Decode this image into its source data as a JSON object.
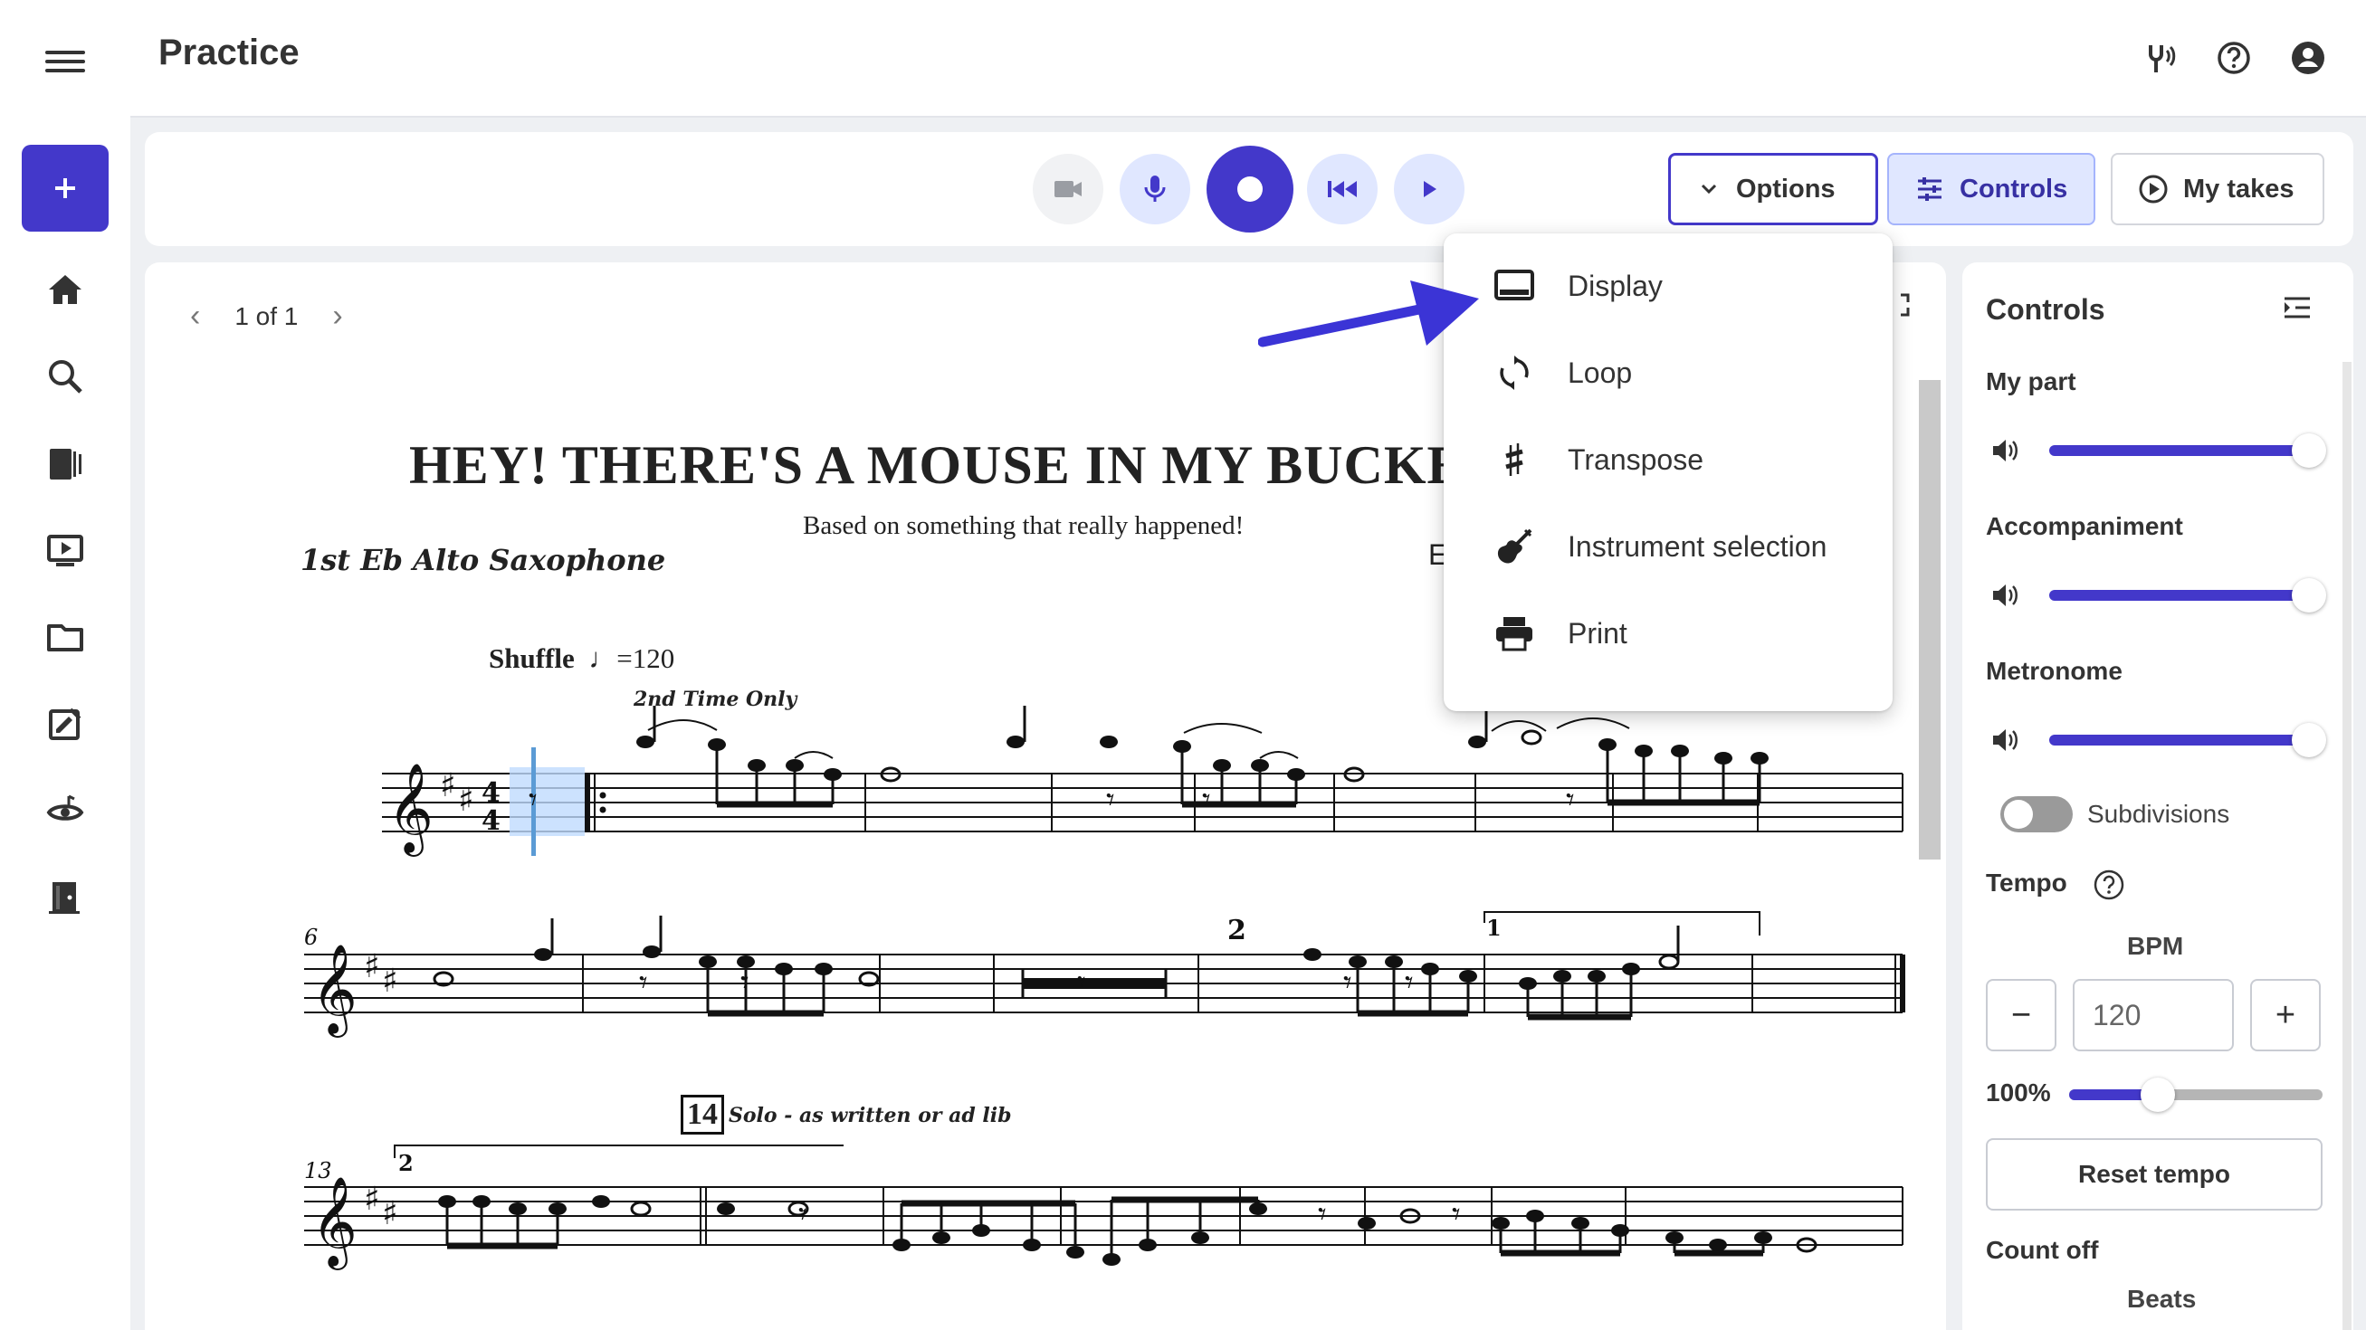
{
  "app": {
    "title": "Practice"
  },
  "toolbar": {
    "options_label": "Options",
    "controls_label": "Controls",
    "takes_label": "My takes"
  },
  "score": {
    "pager": "1 of 1",
    "title": "HEY! THERE'S A MOUSE IN MY BUCKE",
    "subtitle": "Based on something that really happened!",
    "part": "1st Eb Alto Saxophone",
    "composer_initial": "E",
    "tempo_text": "Shuffle",
    "tempo_value": "=120",
    "second_time": "2nd Time Only",
    "rehearsal_mark": "14",
    "solo_text": "Solo - as written or ad lib",
    "measure_numbers": [
      "6",
      "13"
    ],
    "ending_numbers": [
      "1",
      "2"
    ],
    "multirest_count": "2",
    "time_signature": [
      "4",
      "4"
    ]
  },
  "menu": {
    "items": [
      {
        "label": "Display",
        "icon": "display-icon"
      },
      {
        "label": "Loop",
        "icon": "loop-icon"
      },
      {
        "label": "Transpose",
        "icon": "sharp-icon"
      },
      {
        "label": "Instrument selection",
        "icon": "guitar-icon"
      },
      {
        "label": "Print",
        "icon": "printer-icon"
      }
    ]
  },
  "controls": {
    "title": "Controls",
    "my_part": {
      "label": "My part",
      "level": 1.0
    },
    "accompaniment": {
      "label": "Accompaniment",
      "level": 1.0
    },
    "metronome": {
      "label": "Metronome",
      "level": 1.0
    },
    "subdivisions": {
      "label": "Subdivisions",
      "on": false
    },
    "tempo_label": "Tempo",
    "bpm_label": "BPM",
    "bpm_value": "120",
    "tempo_percent": "100%",
    "tempo_level": 0.35,
    "reset_label": "Reset tempo",
    "count_off_label": "Count off",
    "beats_label": "Beats"
  },
  "colors": {
    "accent": "#4338ca",
    "accent_light": "#e0e7ff",
    "highlight": "#bfdbfe"
  }
}
